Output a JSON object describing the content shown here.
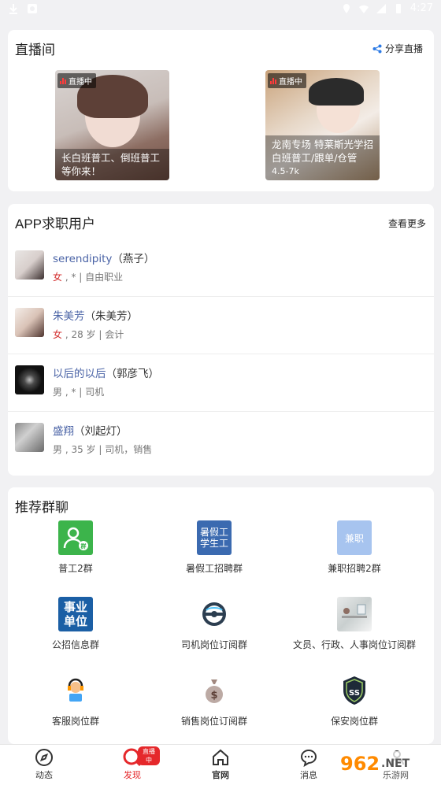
{
  "status_bar": {
    "time": "4:27"
  },
  "live": {
    "title": "直播间",
    "share_label": "分享直播",
    "cards": [
      {
        "badge": "直播中",
        "caption": "长白班普工、倒班普工等你来！",
        "sub": ""
      },
      {
        "badge": "直播中",
        "caption": "龙南专场 特莱斯光学招白班普工/跟单/仓管",
        "sub": "4.5-7k"
      }
    ]
  },
  "users": {
    "title": "APP求职用户",
    "more_label": "查看更多",
    "items": [
      {
        "name": "serendipity",
        "real": "（燕子）",
        "gender": "女",
        "meta": " , * | 自由职业"
      },
      {
        "name": "朱美芳",
        "real": "（朱美芳）",
        "gender": "女",
        "meta": " , 28 岁 | 会计"
      },
      {
        "name": "以后的以后",
        "real": "（郭彦飞）",
        "gender": "男",
        "meta": " , * | 司机"
      },
      {
        "name": "盛翔",
        "real": "（刘起灯）",
        "gender": "男",
        "meta": " , 35 岁 | 司机，销售"
      }
    ]
  },
  "groups": {
    "title": "推荐群聊",
    "items": [
      {
        "label": "普工2群",
        "icon_text": "",
        "icon": "people-icon",
        "color": "#3cb44b"
      },
      {
        "label": "暑假工招聘群",
        "icon_text": "暑假工学生工",
        "icon": "text-icon",
        "color": "#3b6ab0"
      },
      {
        "label": "兼职招聘2群",
        "icon_text": "兼职",
        "icon": "text-icon",
        "color": "#a7c4ef"
      },
      {
        "label": "公招信息群",
        "icon_text": "事业单位",
        "icon": "text-icon",
        "color": "#1b5fa5"
      },
      {
        "label": "司机岗位订阅群",
        "icon_text": "",
        "icon": "steering-wheel-icon",
        "color": "#ffffff"
      },
      {
        "label": "文员、行政、人事岗位订阅群",
        "icon_text": "",
        "icon": "office-desk-icon",
        "color": "#ffffff"
      },
      {
        "label": "客服岗位群",
        "icon_text": "",
        "icon": "headset-agent-icon",
        "color": "#ffffff"
      },
      {
        "label": "销售岗位订阅群",
        "icon_text": "",
        "icon": "money-bag-icon",
        "color": "#ffffff"
      },
      {
        "label": "保安岗位群",
        "icon_text": "",
        "icon": "security-shield-icon",
        "color": "#ffffff"
      }
    ]
  },
  "tabs": [
    {
      "label": "动态",
      "icon": "compass-icon"
    },
    {
      "label": "发现",
      "icon": "discover-search-icon",
      "badge": "直播中"
    },
    {
      "label": "官网",
      "icon": "home-icon"
    },
    {
      "label": "消息",
      "icon": "chat-icon"
    },
    {
      "label": "",
      "icon": "profile-icon"
    }
  ],
  "colors": {
    "accent": "#e5282b",
    "link": "#4a63a6",
    "female": "#d32f2f"
  },
  "watermark": {
    "text": "962.NET",
    "sub": "乐游网"
  }
}
